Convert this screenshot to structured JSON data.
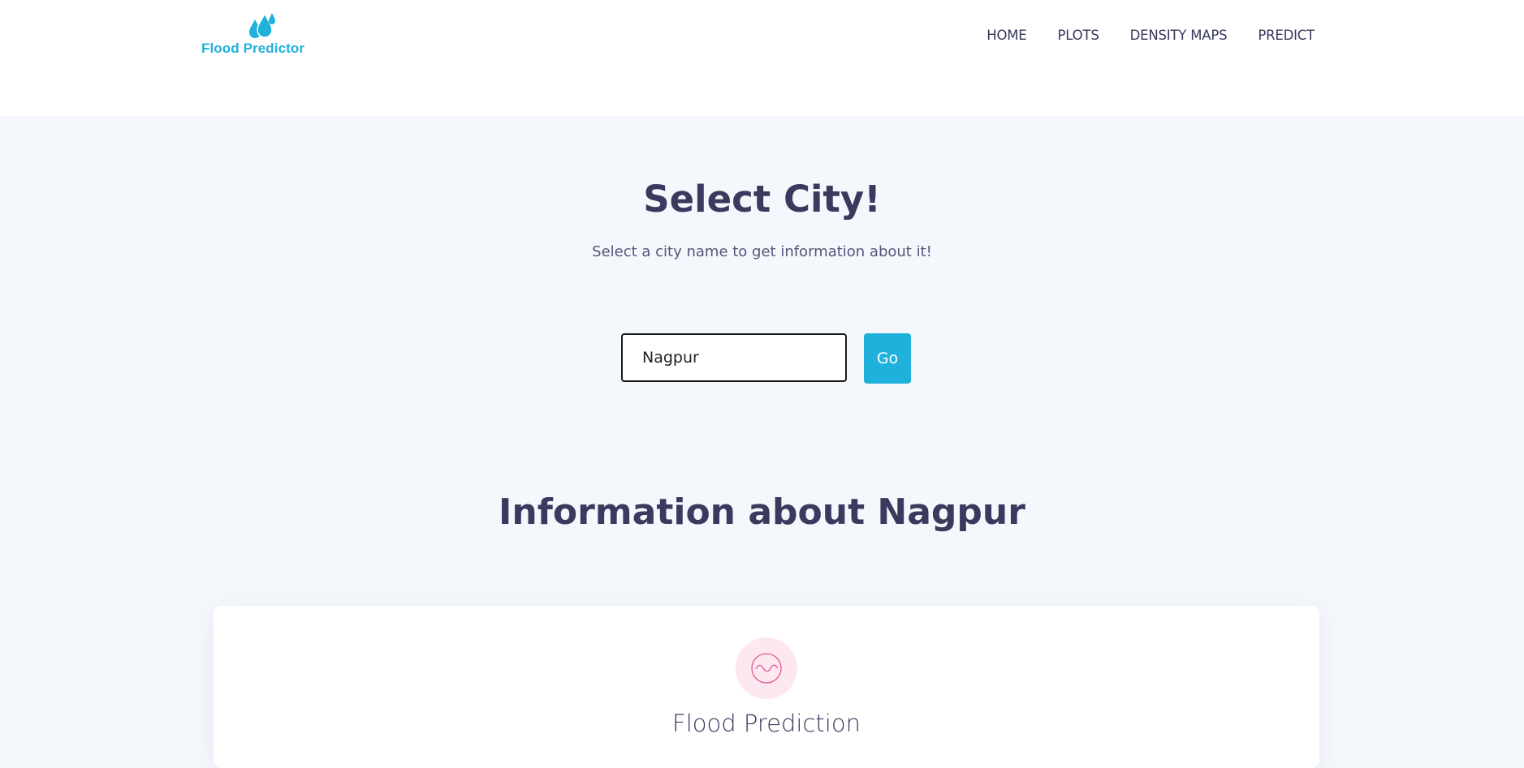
{
  "brand": {
    "name": "Flood Predictor",
    "color": "#1fb1dc",
    "icon": "water-drops-icon"
  },
  "nav": {
    "items": [
      {
        "label": "HOME"
      },
      {
        "label": "PLOTS"
      },
      {
        "label": "DENSITY MAPS"
      },
      {
        "label": "PREDICT"
      }
    ]
  },
  "hero": {
    "title": "Select City!",
    "subtitle": "Select a city name to get information about it!"
  },
  "search": {
    "value": "Nagpur",
    "button_label": "Go"
  },
  "info": {
    "heading": "Information about Nagpur"
  },
  "card": {
    "icon": "wave-icon",
    "icon_color": "#e8588f",
    "title": "Flood Prediction"
  }
}
